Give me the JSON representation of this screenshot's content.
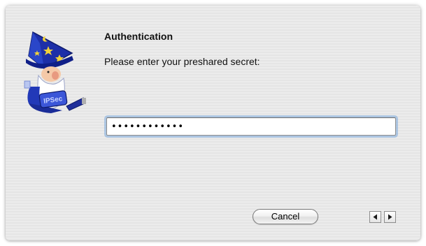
{
  "dialog": {
    "logo": "ipsecuritas-wizard-logo",
    "logo_text": "IPSec",
    "title": "Authentication",
    "prompt": "Please enter your preshared secret:",
    "secret": {
      "value": "............",
      "masked": true
    },
    "cancel_label": "Cancel",
    "nav": {
      "prev_icon": "triangle-left-icon",
      "next_icon": "triangle-right-icon"
    }
  }
}
